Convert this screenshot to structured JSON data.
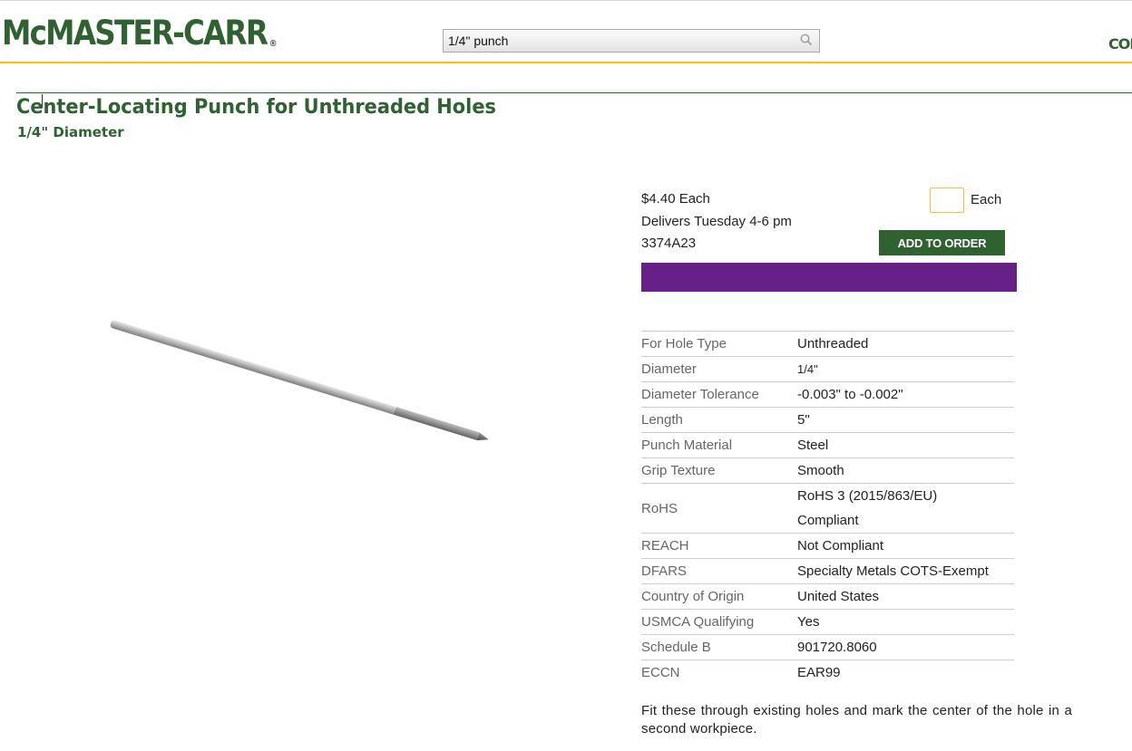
{
  "header": {
    "logo_text": "McMASTER-CARR",
    "logo_reg": "®",
    "search_value": "1/4\" punch",
    "corner_link": "CON"
  },
  "colors": {
    "brand_green": "#2f6131",
    "accent_yellow": "#f2c200",
    "banner_purple": "#662088"
  },
  "product": {
    "title": "Center-Locating Punch for Unthreaded Holes",
    "subtitle": "1/4\" Diameter",
    "image_icon": "punch-rod-image"
  },
  "order": {
    "price": "$4.40 Each",
    "delivery": "Delivers Tuesday 4-6 pm",
    "part_number": "3374A23",
    "quantity_value": "",
    "quantity_unit": "Each",
    "add_button": "ADD TO ORDER"
  },
  "specs": [
    {
      "label": "For Hole Type",
      "value": "Unthreaded"
    },
    {
      "label": "Diameter",
      "value": "1/4\""
    },
    {
      "label": "Diameter Tolerance",
      "value": "-0.003\" to -0.002\""
    },
    {
      "label": "Length",
      "value": "5\""
    },
    {
      "label": "Punch Material",
      "value": "Steel"
    },
    {
      "label": "Grip Texture",
      "value": "Smooth"
    },
    {
      "label": "RoHS",
      "value": "RoHS 3 (2015/863/EU) Compliant"
    },
    {
      "label": "REACH",
      "value": "Not Compliant"
    },
    {
      "label": "DFARS",
      "value": "Specialty Metals COTS-Exempt"
    },
    {
      "label": "Country of Origin",
      "value": "United States"
    },
    {
      "label": "USMCA Qualifying",
      "value": "Yes"
    },
    {
      "label": "Schedule B",
      "value": "901720.8060"
    },
    {
      "label": "ECCN",
      "value": "EAR99"
    }
  ],
  "description": "Fit these through existing holes and mark the center of the hole in a second workpiece."
}
